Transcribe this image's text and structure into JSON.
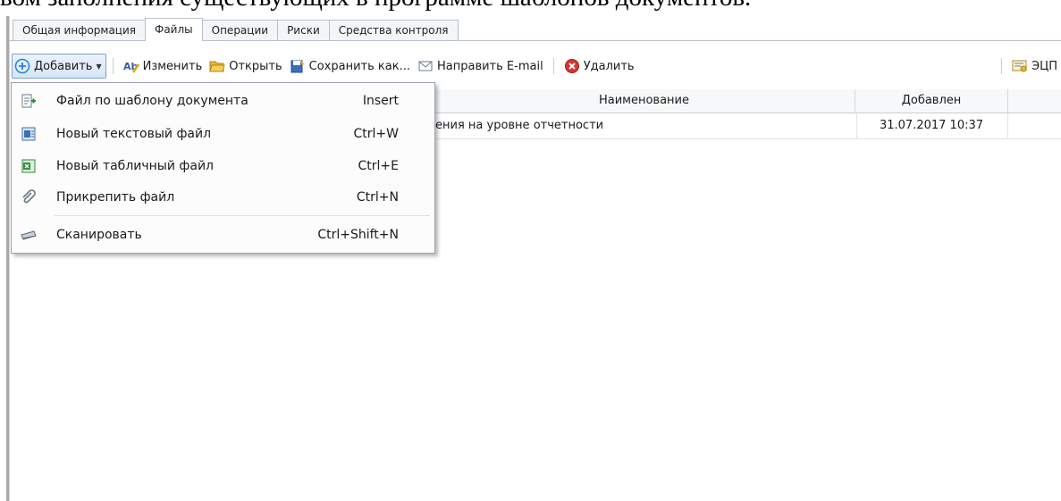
{
  "document": {
    "partial_text": "вом заполнения существующих в программе шаблонов документов."
  },
  "tabs": [
    {
      "label": "Общая информация",
      "active": false
    },
    {
      "label": "Файлы",
      "active": true
    },
    {
      "label": "Операции",
      "active": false
    },
    {
      "label": "Риски",
      "active": false
    },
    {
      "label": "Средства контроля",
      "active": false
    }
  ],
  "toolbar": {
    "add_label": "Добавить",
    "edit_label": "Изменить",
    "open_label": "Открыть",
    "save_as_label": "Сохранить как...",
    "email_label": "Направить E-mail",
    "delete_label": "Удалить",
    "ecp_label": "ЭЦП"
  },
  "grid": {
    "columns": [
      "Наименование",
      "Добавлен"
    ],
    "rows": [
      {
        "name": "ения на уровне отчетности",
        "added": "31.07.2017 10:37"
      }
    ]
  },
  "add_menu": {
    "items": [
      {
        "label": "Файл по шаблону документа",
        "shortcut": "Insert",
        "icon": "template-file-icon"
      },
      {
        "label": "Новый текстовый файл",
        "shortcut": "Ctrl+W",
        "icon": "word-file-icon"
      },
      {
        "label": "Новый табличный файл",
        "shortcut": "Ctrl+E",
        "icon": "excel-file-icon"
      },
      {
        "label": "Прикрепить файл",
        "shortcut": "Ctrl+N",
        "icon": "paperclip-icon"
      },
      {
        "label": "Сканировать",
        "shortcut": "Ctrl+Shift+N",
        "icon": "scanner-icon"
      }
    ]
  },
  "colors": {
    "accent_blue": "#2f7fd3",
    "delete_red": "#d9342b",
    "excel_green": "#2e8b3d",
    "folder_yellow": "#e8b63a"
  }
}
